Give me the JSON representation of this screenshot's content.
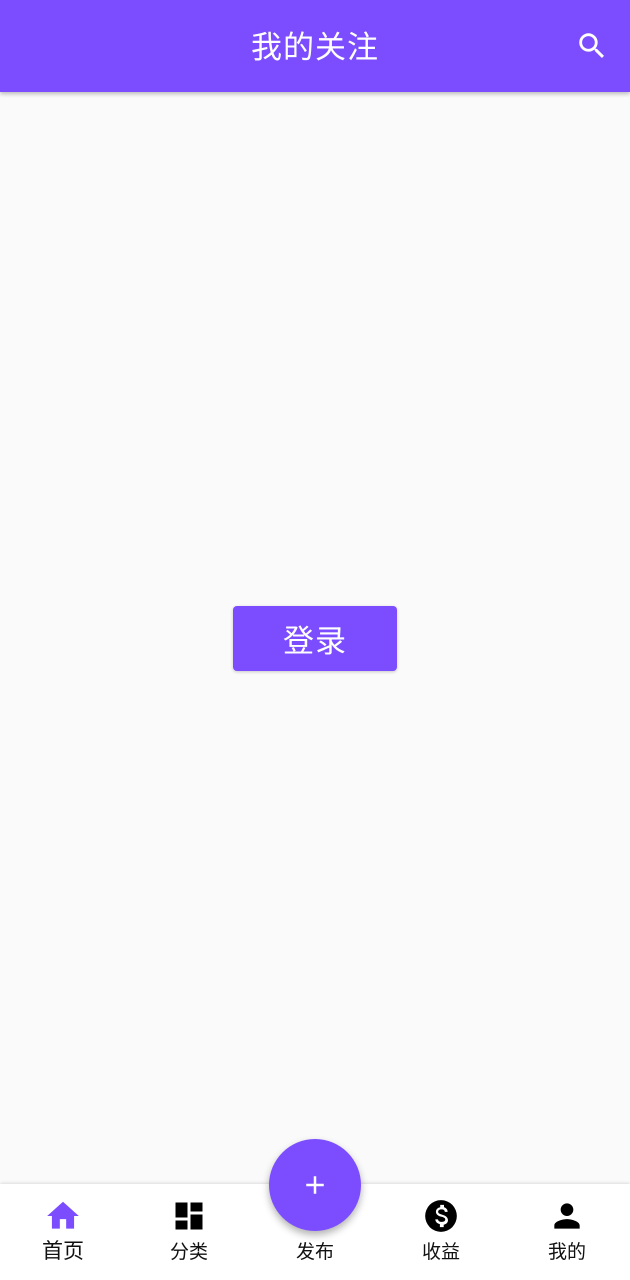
{
  "app_bar": {
    "title": "我的关注",
    "search_icon": "search-icon"
  },
  "main": {
    "login_label": "登录"
  },
  "bottom_nav": {
    "items": [
      {
        "label": "首页",
        "icon": "home-icon",
        "active": true
      },
      {
        "label": "分类",
        "icon": "dashboard-icon",
        "active": false
      },
      {
        "label": "发布",
        "icon": "add-icon",
        "active": false
      },
      {
        "label": "收益",
        "icon": "dollar-icon",
        "active": false
      },
      {
        "label": "我的",
        "icon": "person-icon",
        "active": false
      }
    ]
  },
  "colors": {
    "primary": "#7c4dff",
    "background": "#fafafa",
    "nav_background": "#ffffff",
    "text_dark": "#111111"
  }
}
